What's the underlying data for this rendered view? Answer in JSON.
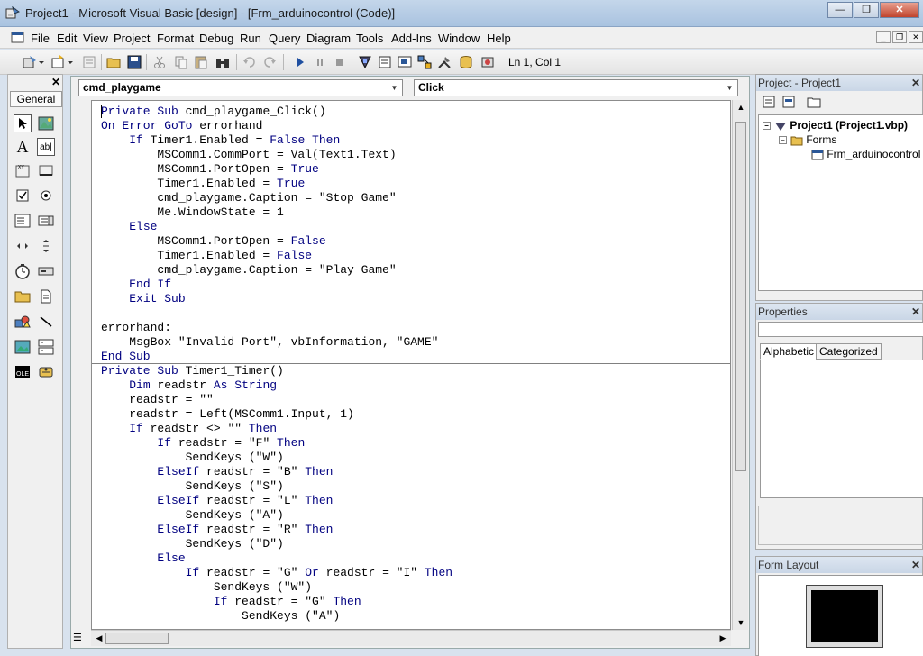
{
  "window": {
    "title": "Project1 - Microsoft Visual Basic [design] - [Frm_arduinocontrol (Code)]",
    "minimize_glyph": "—",
    "restore_glyph": "❐",
    "close_glyph": "✕"
  },
  "menu": {
    "items": [
      "File",
      "Edit",
      "View",
      "Project",
      "Format",
      "Debug",
      "Run",
      "Query",
      "Diagram",
      "Tools",
      "Add-Ins",
      "Window",
      "Help"
    ],
    "mdi_minimize": "_",
    "mdi_restore": "❐",
    "mdi_close": "✕"
  },
  "toolbar": {
    "position": "Ln 1, Col 1"
  },
  "toolbox": {
    "tab_label": "General",
    "close_glyph": "✕"
  },
  "code_window": {
    "object_combo": "cmd_playgame",
    "procedure_combo": "Click",
    "lines": [
      [
        {
          "t": "Private Sub ",
          "k": true
        },
        {
          "t": "cmd_playgame_Click()",
          "k": false
        }
      ],
      [
        {
          "t": "On Error GoTo ",
          "k": true
        },
        {
          "t": "errorhand",
          "k": false
        }
      ],
      [
        {
          "t": "    ",
          "k": false
        },
        {
          "t": "If ",
          "k": true
        },
        {
          "t": "Timer1.Enabled = ",
          "k": false
        },
        {
          "t": "False Then",
          "k": true
        }
      ],
      [
        {
          "t": "        MSComm1.CommPort = Val(Text1.Text)",
          "k": false
        }
      ],
      [
        {
          "t": "        MSComm1.PortOpen = ",
          "k": false
        },
        {
          "t": "True",
          "k": true
        }
      ],
      [
        {
          "t": "        Timer1.Enabled = ",
          "k": false
        },
        {
          "t": "True",
          "k": true
        }
      ],
      [
        {
          "t": "        cmd_playgame.Caption = \"Stop Game\"",
          "k": false
        }
      ],
      [
        {
          "t": "        Me.WindowState = 1",
          "k": false
        }
      ],
      [
        {
          "t": "    ",
          "k": false
        },
        {
          "t": "Else",
          "k": true
        }
      ],
      [
        {
          "t": "        MSComm1.PortOpen = ",
          "k": false
        },
        {
          "t": "False",
          "k": true
        }
      ],
      [
        {
          "t": "        Timer1.Enabled = ",
          "k": false
        },
        {
          "t": "False",
          "k": true
        }
      ],
      [
        {
          "t": "        cmd_playgame.Caption = \"Play Game\"",
          "k": false
        }
      ],
      [
        {
          "t": "    ",
          "k": false
        },
        {
          "t": "End If",
          "k": true
        }
      ],
      [
        {
          "t": "    ",
          "k": false
        },
        {
          "t": "Exit Sub",
          "k": true
        }
      ],
      [
        {
          "t": "",
          "k": false
        }
      ],
      [
        {
          "t": "errorhand:",
          "k": false
        }
      ],
      [
        {
          "t": "    MsgBox \"Invalid Port\", vbInformation, \"GAME\"",
          "k": false
        }
      ],
      [
        {
          "t": "End Sub",
          "k": true
        }
      ],
      [
        {
          "t": "Private Sub ",
          "k": true
        },
        {
          "t": "Timer1_Timer()",
          "k": false
        }
      ],
      [
        {
          "t": "    ",
          "k": false
        },
        {
          "t": "Dim ",
          "k": true
        },
        {
          "t": "readstr ",
          "k": false
        },
        {
          "t": "As String",
          "k": true
        }
      ],
      [
        {
          "t": "    readstr = \"\"",
          "k": false
        }
      ],
      [
        {
          "t": "    readstr = Left(MSComm1.Input, 1)",
          "k": false
        }
      ],
      [
        {
          "t": "    ",
          "k": false
        },
        {
          "t": "If ",
          "k": true
        },
        {
          "t": "readstr <> \"\" ",
          "k": false
        },
        {
          "t": "Then",
          "k": true
        }
      ],
      [
        {
          "t": "        ",
          "k": false
        },
        {
          "t": "If ",
          "k": true
        },
        {
          "t": "readstr = \"F\" ",
          "k": false
        },
        {
          "t": "Then",
          "k": true
        }
      ],
      [
        {
          "t": "            SendKeys (\"W\")",
          "k": false
        }
      ],
      [
        {
          "t": "        ",
          "k": false
        },
        {
          "t": "ElseIf ",
          "k": true
        },
        {
          "t": "readstr = \"B\" ",
          "k": false
        },
        {
          "t": "Then",
          "k": true
        }
      ],
      [
        {
          "t": "            SendKeys (\"S\")",
          "k": false
        }
      ],
      [
        {
          "t": "        ",
          "k": false
        },
        {
          "t": "ElseIf ",
          "k": true
        },
        {
          "t": "readstr = \"L\" ",
          "k": false
        },
        {
          "t": "Then",
          "k": true
        }
      ],
      [
        {
          "t": "            SendKeys (\"A\")",
          "k": false
        }
      ],
      [
        {
          "t": "        ",
          "k": false
        },
        {
          "t": "ElseIf ",
          "k": true
        },
        {
          "t": "readstr = \"R\" ",
          "k": false
        },
        {
          "t": "Then",
          "k": true
        }
      ],
      [
        {
          "t": "            SendKeys (\"D\")",
          "k": false
        }
      ],
      [
        {
          "t": "        ",
          "k": false
        },
        {
          "t": "Else",
          "k": true
        }
      ],
      [
        {
          "t": "            ",
          "k": false
        },
        {
          "t": "If ",
          "k": true
        },
        {
          "t": "readstr = \"G\" ",
          "k": false
        },
        {
          "t": "Or ",
          "k": true
        },
        {
          "t": "readstr = \"I\" ",
          "k": false
        },
        {
          "t": "Then",
          "k": true
        }
      ],
      [
        {
          "t": "                SendKeys (\"W\")",
          "k": false
        }
      ],
      [
        {
          "t": "                ",
          "k": false
        },
        {
          "t": "If ",
          "k": true
        },
        {
          "t": "readstr = \"G\" ",
          "k": false
        },
        {
          "t": "Then",
          "k": true
        }
      ],
      [
        {
          "t": "                    SendKeys (\"A\")",
          "k": false
        }
      ]
    ]
  },
  "project_pane": {
    "title": "Project - Project1",
    "close_glyph": "✕",
    "tree": {
      "root": "Project1 (Project1.vbp)",
      "folder": "Forms",
      "form": "Frm_arduinocontrol (F"
    }
  },
  "properties_pane": {
    "title": "Properties",
    "close_glyph": "✕",
    "tabs": [
      "Alphabetic",
      "Categorized"
    ]
  },
  "form_layout_pane": {
    "title": "Form Layout",
    "close_glyph": "✕"
  },
  "colors": {
    "keyword": "#000080",
    "code_text": "#000000",
    "code_bg": "#ffffff"
  }
}
